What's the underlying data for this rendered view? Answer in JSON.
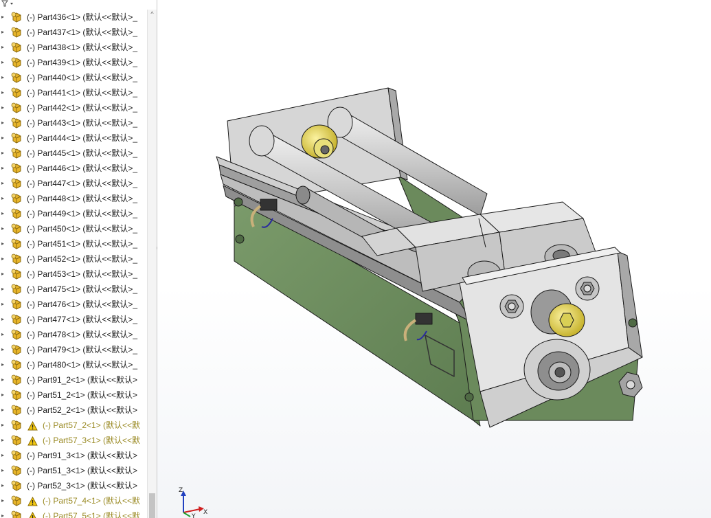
{
  "tree": {
    "filter_icon": "filter-icon",
    "rows": [
      {
        "label": "(-) Part436<1> (默认<<默认>_",
        "warn": false
      },
      {
        "label": "(-) Part437<1> (默认<<默认>_",
        "warn": false
      },
      {
        "label": "(-) Part438<1> (默认<<默认>_",
        "warn": false
      },
      {
        "label": "(-) Part439<1> (默认<<默认>_",
        "warn": false
      },
      {
        "label": "(-) Part440<1> (默认<<默认>_",
        "warn": false
      },
      {
        "label": "(-) Part441<1> (默认<<默认>_",
        "warn": false
      },
      {
        "label": "(-) Part442<1> (默认<<默认>_",
        "warn": false
      },
      {
        "label": "(-) Part443<1> (默认<<默认>_",
        "warn": false
      },
      {
        "label": "(-) Part444<1> (默认<<默认>_",
        "warn": false
      },
      {
        "label": "(-) Part445<1> (默认<<默认>_",
        "warn": false
      },
      {
        "label": "(-) Part446<1> (默认<<默认>_",
        "warn": false
      },
      {
        "label": "(-) Part447<1> (默认<<默认>_",
        "warn": false
      },
      {
        "label": "(-) Part448<1> (默认<<默认>_",
        "warn": false
      },
      {
        "label": "(-) Part449<1> (默认<<默认>_",
        "warn": false
      },
      {
        "label": "(-) Part450<1> (默认<<默认>_",
        "warn": false
      },
      {
        "label": "(-) Part451<1> (默认<<默认>_",
        "warn": false
      },
      {
        "label": "(-) Part452<1> (默认<<默认>_",
        "warn": false
      },
      {
        "label": "(-) Part453<1> (默认<<默认>_",
        "warn": false
      },
      {
        "label": "(-) Part475<1> (默认<<默认>_",
        "warn": false
      },
      {
        "label": "(-) Part476<1> (默认<<默认>_",
        "warn": false
      },
      {
        "label": "(-) Part477<1> (默认<<默认>_",
        "warn": false
      },
      {
        "label": "(-) Part478<1> (默认<<默认>_",
        "warn": false
      },
      {
        "label": "(-) Part479<1> (默认<<默认>_",
        "warn": false
      },
      {
        "label": "(-) Part480<1> (默认<<默认>_",
        "warn": false
      },
      {
        "label": "(-) Part91_2<1> (默认<<默认>",
        "warn": false
      },
      {
        "label": "(-) Part51_2<1> (默认<<默认>",
        "warn": false
      },
      {
        "label": "(-) Part52_2<1> (默认<<默认>",
        "warn": false
      },
      {
        "label": "(-) Part57_2<1> (默认<<默",
        "warn": true
      },
      {
        "label": "(-) Part57_3<1> (默认<<默",
        "warn": true
      },
      {
        "label": "(-) Part91_3<1> (默认<<默认>",
        "warn": false
      },
      {
        "label": "(-) Part51_3<1> (默认<<默认>",
        "warn": false
      },
      {
        "label": "(-) Part52_3<1> (默认<<默认>",
        "warn": false
      },
      {
        "label": "(-) Part57_4<1> (默认<<默",
        "warn": true
      },
      {
        "label": "(-) Part57_5<1> (默认<<默",
        "warn": true
      }
    ]
  },
  "triad": {
    "x_label": "X",
    "y_label": "Y",
    "z_label": "Z"
  },
  "colors": {
    "part_icon": "#e8b52a",
    "warning_icon": "#f2c811",
    "warning_text": "#9a8a24",
    "model_green": "#6e8f5f",
    "model_grey": "#d8d8d8",
    "axis_x": "#d02020",
    "axis_y": "#20a030",
    "axis_z": "#2040c0"
  }
}
